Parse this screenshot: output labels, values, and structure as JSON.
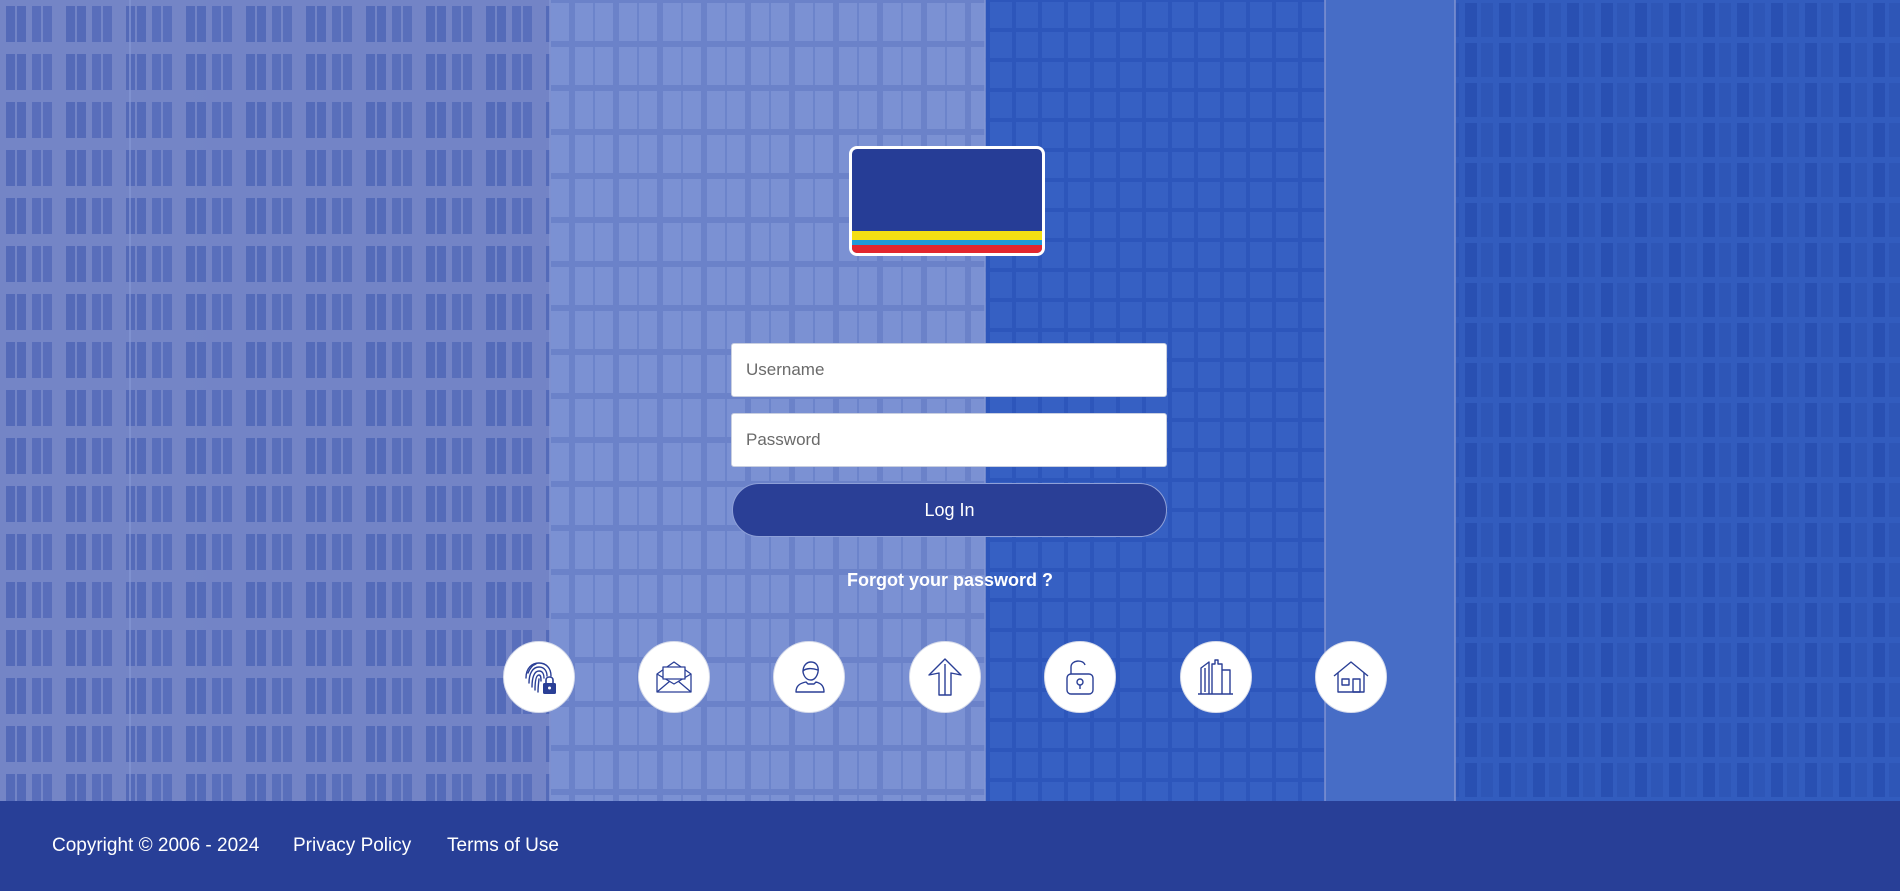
{
  "login": {
    "username_placeholder": "Username",
    "password_placeholder": "Password",
    "login_label": "Log In",
    "forgot_label": "Forgot your password ?"
  },
  "quick_links": [
    {
      "icon": "fingerprint-lock-icon"
    },
    {
      "icon": "envelope-icon"
    },
    {
      "icon": "user-icon"
    },
    {
      "icon": "arrow-up-icon"
    },
    {
      "icon": "padlock-icon"
    },
    {
      "icon": "buildings-icon"
    },
    {
      "icon": "house-icon"
    }
  ],
  "footer": {
    "copyright": "Copyright © 2006 - 2024",
    "privacy": "Privacy Policy",
    "terms": "Terms of Use"
  },
  "colors": {
    "brand_blue": "#283f97",
    "logo_yellow": "#f3df14",
    "logo_light_blue": "#1f9ad8",
    "logo_red": "#e2262e"
  }
}
